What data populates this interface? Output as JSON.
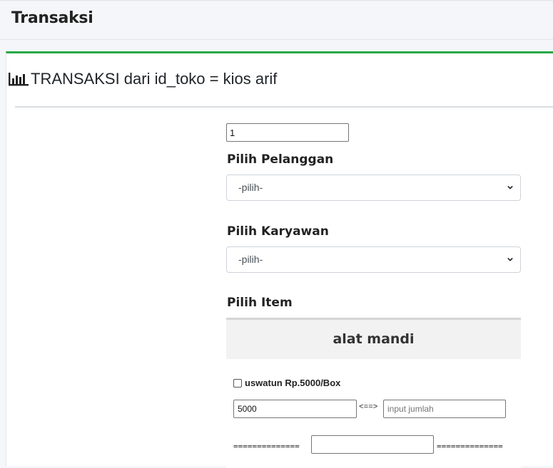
{
  "topbar": {
    "title": "Transaksi"
  },
  "card": {
    "title": "TRANSAKSI dari id_toko = kios arif",
    "icon": "bar-chart-icon",
    "accent": "#28a745"
  },
  "form": {
    "number_value": "1",
    "pelanggan": {
      "label": "Pilih Pelanggan",
      "selected": "-pilih-"
    },
    "karyawan": {
      "label": "Pilih Karyawan",
      "selected": "-pilih-"
    },
    "item_label": "Pilih Item",
    "category": {
      "title": "alat mandi",
      "item": {
        "label": "uswatun Rp.5000/Box",
        "price_value": "5000",
        "arrow": "<==>",
        "qty_placeholder": "input jumlah"
      },
      "separator_left": "==============",
      "separator_right": "==============",
      "total_value": ""
    }
  }
}
